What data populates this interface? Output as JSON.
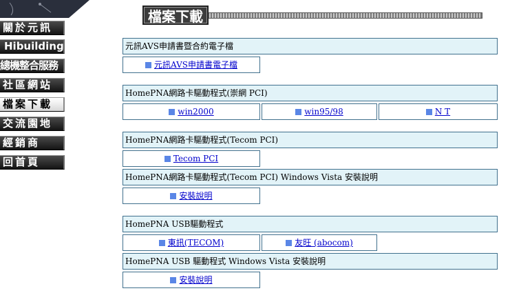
{
  "nav": {
    "items": [
      {
        "label": "關於元訊"
      },
      {
        "label": "Hibuilding"
      },
      {
        "label": "總機整合服務"
      },
      {
        "label": "社區網站"
      },
      {
        "label": "檔案下載"
      },
      {
        "label": "交流園地"
      },
      {
        "label": "經銷商"
      },
      {
        "label": "回首頁"
      }
    ],
    "active_index": 4
  },
  "header": {
    "title": "檔案下載"
  },
  "sections": [
    {
      "title": "元訊AVS申請書暨合約電子檔",
      "links": [
        "元訊AVS申請書電子檔"
      ]
    },
    {
      "title": "HomePNA網路卡驅動程式(崇網 PCI)",
      "links": [
        "win2000",
        "win95/98",
        "N T"
      ]
    },
    {
      "title": "HomePNA網路卡驅動程式(Tecom PCI)",
      "links": [
        "Tecom PCI"
      ]
    },
    {
      "title": "HomePNA網路卡驅動程式(Tecom PCI) Windows Vista 安裝說明",
      "links": [
        "安裝說明"
      ]
    },
    {
      "title": "HomePNA USB驅動程式",
      "links": [
        "東訊(TECOM)",
        "友旺 (abocom)"
      ]
    },
    {
      "title": "HomePNA USB 驅動程式 Windows Vista 安裝說明",
      "links": [
        "安裝說明"
      ]
    }
  ],
  "colors": {
    "section_bg": "#e2f3f8",
    "border": "#3f6f8c",
    "bullet": "#5a86e6",
    "link": "#0000cc"
  }
}
